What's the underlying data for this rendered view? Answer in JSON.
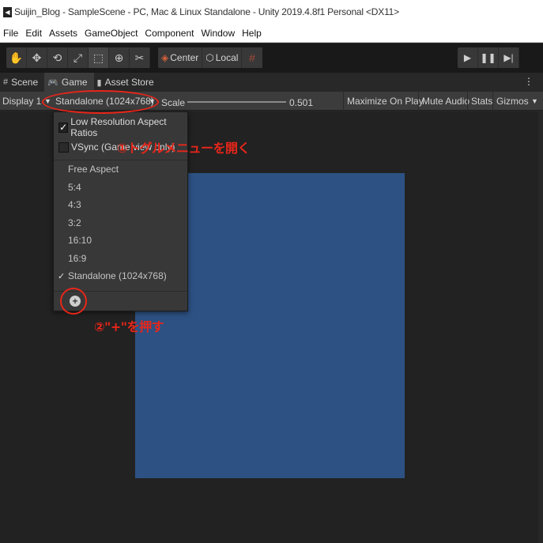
{
  "window": {
    "title": "Suijin_Blog - SampleScene - PC, Mac & Linux Standalone - Unity 2019.4.8f1 Personal <DX11>"
  },
  "menu": [
    "File",
    "Edit",
    "Assets",
    "GameObject",
    "Component",
    "Window",
    "Help"
  ],
  "toolbar": {
    "tools": [
      "hand-icon",
      "move-icon",
      "rotate-icon",
      "scale-icon",
      "rect-icon",
      "transform-icon",
      "custom-tool-icon"
    ],
    "pivot_label": "Center",
    "space_label": "Local"
  },
  "tabs": [
    {
      "label": "Scene",
      "icon": "grid-icon",
      "active": false
    },
    {
      "label": "Game",
      "icon": "gamepad-icon",
      "active": true
    },
    {
      "label": "Asset Store",
      "icon": "bag-icon",
      "active": false
    }
  ],
  "gamebar": {
    "display": "Display 1",
    "resolution": "Standalone (1024x768)",
    "scale_label": "Scale",
    "scale_value": "0.501",
    "maximize": "Maximize On Play",
    "mute": "Mute Audio",
    "stats": "Stats",
    "gizmos": "Gizmos"
  },
  "dropdown": {
    "low_res": "Low Resolution Aspect Ratios",
    "vsync": "VSync (Game view only)",
    "aspects": [
      "Free Aspect",
      "5:4",
      "4:3",
      "3:2",
      "16:10",
      "16:9",
      "Standalone (1024x768)"
    ],
    "selected": "Standalone (1024x768)"
  },
  "annotations": {
    "step1": "①トグルメニューを開く",
    "step2": "②\"+\"を押す"
  },
  "colors": {
    "game_view": "#2d5183",
    "annotation": "#e8261a"
  }
}
